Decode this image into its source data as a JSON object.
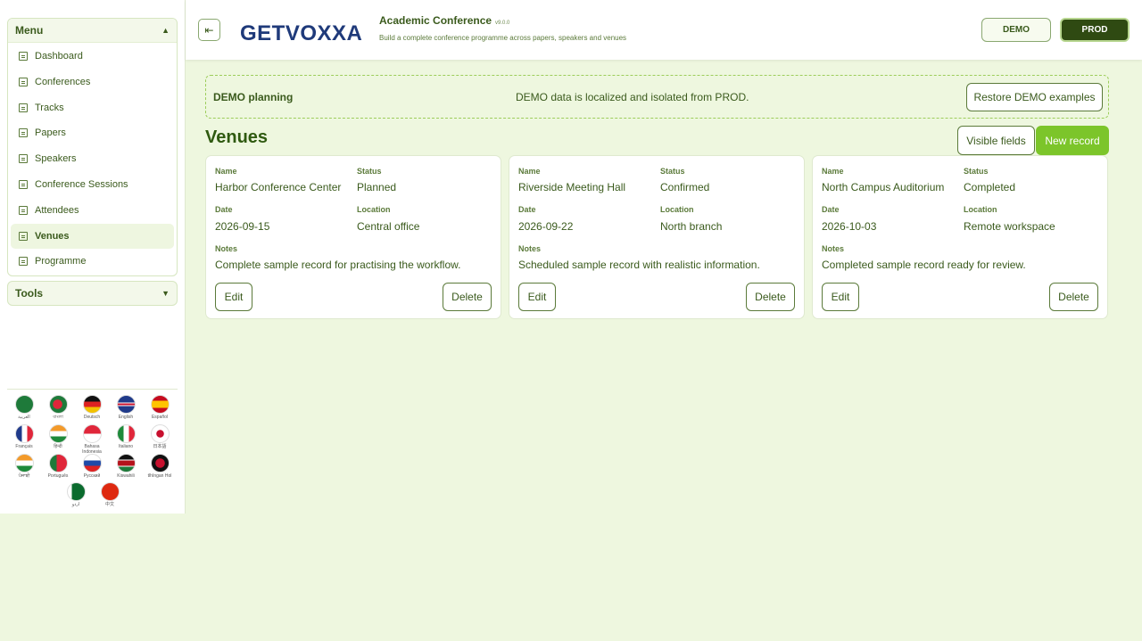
{
  "sidebar": {
    "menu_title": "Menu",
    "items": [
      {
        "label": "Dashboard"
      },
      {
        "label": "Conferences"
      },
      {
        "label": "Tracks"
      },
      {
        "label": "Papers"
      },
      {
        "label": "Speakers"
      },
      {
        "label": "Conference Sessions"
      },
      {
        "label": "Attendees"
      },
      {
        "label": "Venues",
        "active": true
      },
      {
        "label": "Programme"
      }
    ],
    "tools_title": "Tools",
    "languages": [
      {
        "label": "العربية"
      },
      {
        "label": "বাংলা"
      },
      {
        "label": "Deutsch"
      },
      {
        "label": "English"
      },
      {
        "label": "Español"
      },
      {
        "label": "Français"
      },
      {
        "label": "हिन्दी"
      },
      {
        "label": "Bahasa Indonesia"
      },
      {
        "label": "Italiano"
      },
      {
        "label": "日本語"
      },
      {
        "label": "ਪੰਜਾਬੀ"
      },
      {
        "label": "Português"
      },
      {
        "label": "Русский"
      },
      {
        "label": "Kiswahili"
      },
      {
        "label": "tlhIngan Hol"
      },
      {
        "label": "اردو"
      },
      {
        "label": "中文"
      }
    ]
  },
  "header": {
    "logo_text": "GETVOXXA",
    "app_title": "Academic Conference",
    "version": "v9.0.0",
    "subtitle": "Build a complete conference programme across papers, speakers and venues",
    "env_demo": "DEMO",
    "env_prod": "PROD"
  },
  "banner": {
    "title": "DEMO planning",
    "message": "DEMO data is localized and isolated from PROD.",
    "restore_label": "Restore DEMO examples"
  },
  "section": {
    "title": "Venues",
    "visible_fields_label": "Visible fields",
    "new_record_label": "New record"
  },
  "field_labels": {
    "name": "Name",
    "status": "Status",
    "date": "Date",
    "location": "Location",
    "notes": "Notes",
    "edit": "Edit",
    "delete": "Delete"
  },
  "cards": [
    {
      "name": "Harbor Conference Center",
      "status": "Planned",
      "date": "2026-09-15",
      "location": "Central office",
      "notes": "Complete sample record for practising the workflow."
    },
    {
      "name": "Riverside Meeting Hall",
      "status": "Confirmed",
      "date": "2026-09-22",
      "location": "North branch",
      "notes": "Scheduled sample record with realistic information."
    },
    {
      "name": "North Campus Auditorium",
      "status": "Completed",
      "date": "2026-10-03",
      "location": "Remote workspace",
      "notes": "Completed sample record ready for review."
    }
  ],
  "colors": {
    "accent": "#7cc52a",
    "prod_bg": "#2f4a12",
    "page_bg": "#eef7df"
  }
}
